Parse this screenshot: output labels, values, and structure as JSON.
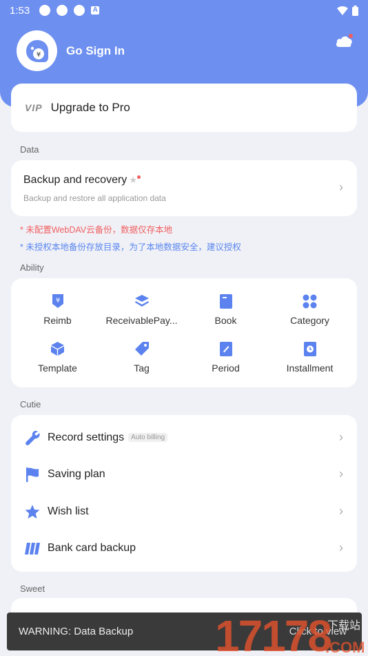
{
  "status": {
    "time": "1:53",
    "a_icon": "A"
  },
  "header": {
    "signin": "Go Sign In",
    "avatar_glyph": "¥"
  },
  "pro": {
    "badge": "VIP",
    "label": "Upgrade to Pro"
  },
  "sections": {
    "data": "Data",
    "ability": "Ability",
    "cutie": "Cutie",
    "sweet": "Sweet"
  },
  "backup": {
    "title": "Backup and recovery",
    "subtitle": "Backup and restore all application data"
  },
  "notices": {
    "red": "* 未配置WebDAV云备份，数据仅存本地",
    "blue": "* 未授权本地备份存放目录，为了本地数据安全，建议授权"
  },
  "ability": [
    {
      "label": "Reimb",
      "icon": "reimb-icon"
    },
    {
      "label": "ReceivablePay...",
      "icon": "layers-icon"
    },
    {
      "label": "Book",
      "icon": "book-icon"
    },
    {
      "label": "Category",
      "icon": "category-icon"
    },
    {
      "label": "Template",
      "icon": "cube-icon"
    },
    {
      "label": "Tag",
      "icon": "tag-icon"
    },
    {
      "label": "Period",
      "icon": "period-icon"
    },
    {
      "label": "Installment",
      "icon": "clock-icon"
    }
  ],
  "cutie": [
    {
      "label": "Record settings",
      "tag": "Auto billing",
      "icon": "wrench-icon"
    },
    {
      "label": "Saving plan",
      "icon": "flag-icon"
    },
    {
      "label": "Wish list",
      "icon": "star-icon"
    },
    {
      "label": "Bank card backup",
      "icon": "card-icon"
    }
  ],
  "toast": {
    "message": "WARNING: Data Backup",
    "action": "Click to view"
  },
  "watermark": {
    "text": "17178",
    "sub": "下载站",
    "domain": ".COM"
  },
  "colors": {
    "accent": "#6d8ff0",
    "icon": "#5b82ee",
    "warning_red": "#f06060",
    "notice_blue": "#5a86ee"
  }
}
